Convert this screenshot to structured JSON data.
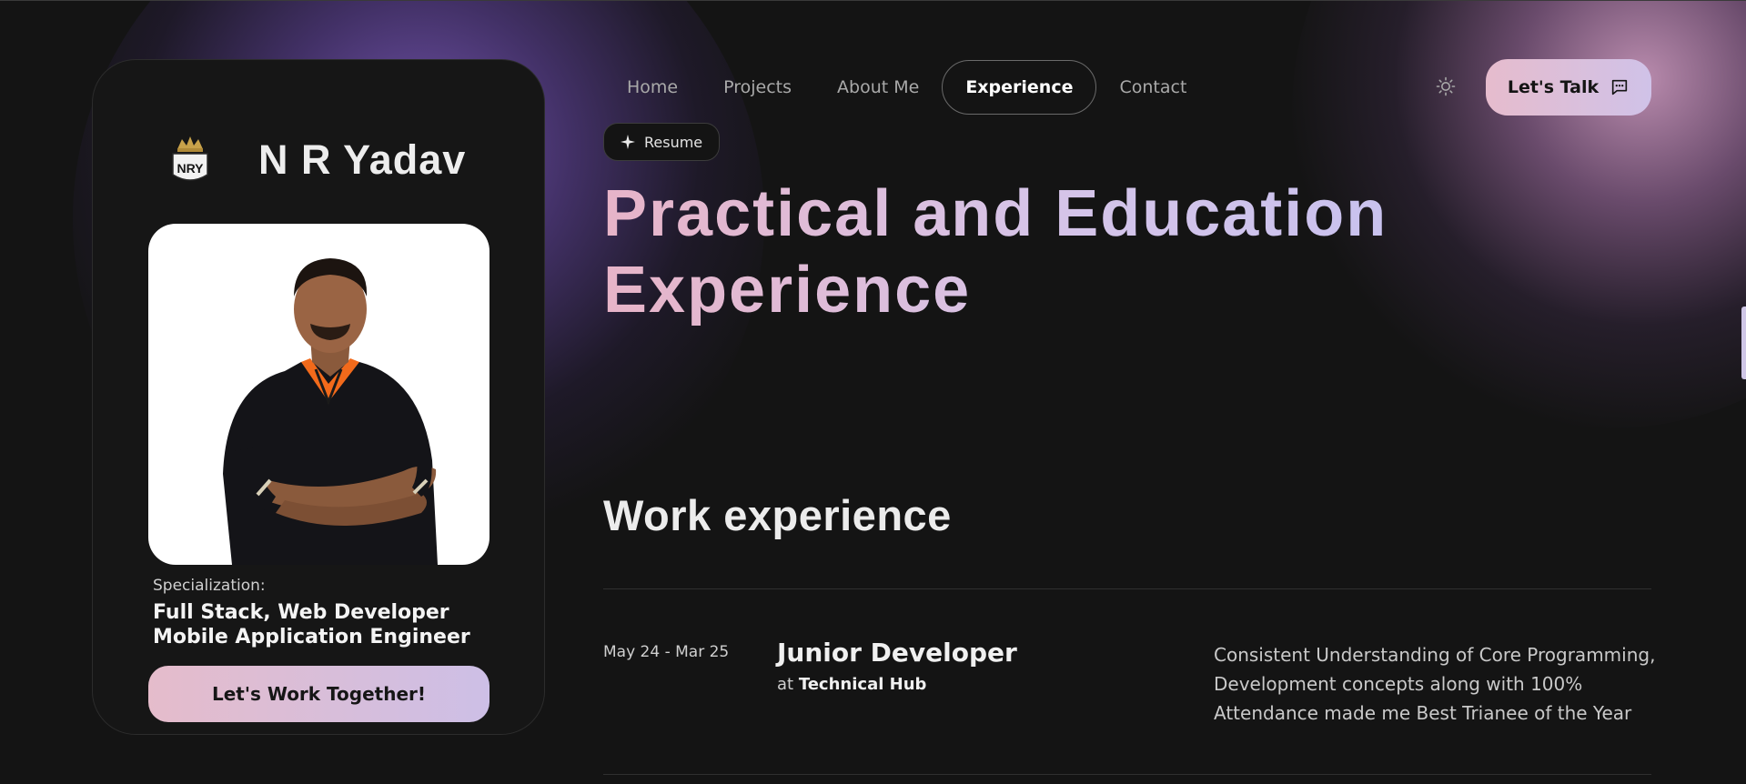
{
  "profile": {
    "logo_text": "NRY",
    "name": "N R Yadav",
    "specialization_label": "Specialization:",
    "specialization_line1": "Full Stack, Web Developer",
    "specialization_line2": "Mobile Application Engineer",
    "cta_label": "Let's Work Together!"
  },
  "nav": {
    "items": [
      {
        "label": "Home"
      },
      {
        "label": "Projects"
      },
      {
        "label": "About Me"
      },
      {
        "label": "Experience",
        "active": true
      },
      {
        "label": "Contact"
      }
    ],
    "theme_icon": "sun-icon",
    "talk_label": "Let's Talk",
    "talk_icon": "chat-icon"
  },
  "hero": {
    "badge_label": "Resume",
    "badge_icon": "sparkle-icon",
    "headline_line1": "Practical and Education",
    "headline_line2": "Experience"
  },
  "work": {
    "title": "Work experience",
    "jobs": [
      {
        "date": "May 24 - Mar 25",
        "title": "Junior Developer",
        "at_prefix": "at",
        "company": "Technical Hub",
        "description": "Consistent Understanding of Core Programming, Development concepts along with 100% Attendance made me Best Trianee of the Year"
      }
    ]
  },
  "colors": {
    "background": "#141414",
    "accent_gradient_start": "#e6bccd",
    "accent_gradient_end": "#d0c2e8",
    "glow_purple": "#8460c8",
    "glow_pink": "#d6a0c8"
  }
}
